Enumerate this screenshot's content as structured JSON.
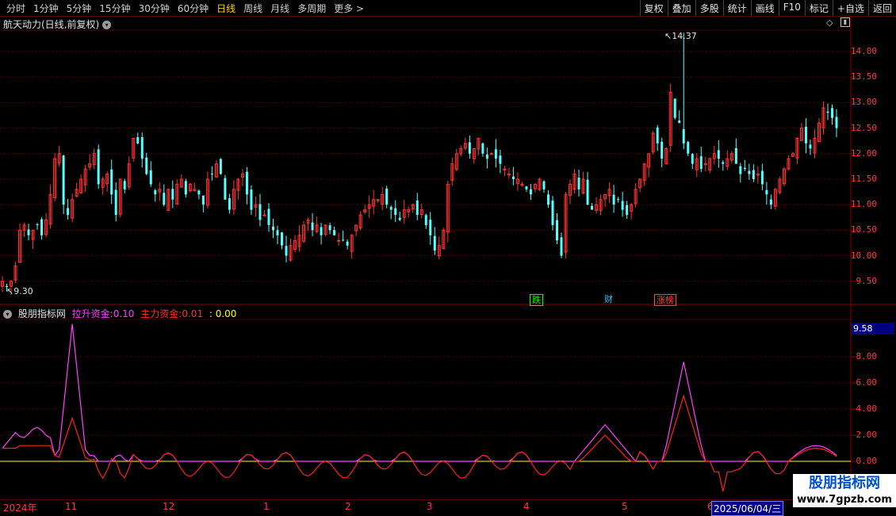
{
  "toolbar": {
    "periods": [
      "分时",
      "1分钟",
      "5分钟",
      "15分钟",
      "30分钟",
      "60分钟",
      "日线",
      "周线",
      "月线",
      "多周期",
      "更多 >"
    ],
    "active_period": "日线",
    "actions": [
      "复权",
      "叠加",
      "多股",
      "统计",
      "画线",
      "F10",
      "标记",
      "+自选",
      "返回"
    ]
  },
  "main_chart": {
    "title": "航天动力(日线,前复权)",
    "high_label": "14.37",
    "low_label": "9.30",
    "y_axis": [
      "14.00",
      "13.50",
      "13.00",
      "12.50",
      "12.00",
      "11.50",
      "11.00",
      "10.50",
      "10.00",
      "9.50"
    ],
    "markers": [
      {
        "text": "跌",
        "color": "#00ff00"
      },
      {
        "text": "财",
        "color": "#40c0ff"
      },
      {
        "text": "涨榜",
        "color": "#ff4040"
      }
    ],
    "up_color": "#ff3232",
    "down_color": "#54ffff"
  },
  "indicator": {
    "name": "股朋指标网",
    "line1_label": "拉升资金:",
    "line1_value": "0.10",
    "line2_label": "主力资金:",
    "line2_value": "0.01",
    "line3_value": ": 0.00",
    "current_value": "9.58",
    "y_axis": [
      "8.00",
      "6.00",
      "4.00",
      "2.00",
      "0.00"
    ],
    "colors": {
      "line1": "#ff40ff",
      "line2": "#ff2020",
      "line3": "#ffff00"
    }
  },
  "date_axis": {
    "labels": [
      "2024年",
      "11",
      "12",
      "1",
      "2",
      "3",
      "4",
      "5",
      "6"
    ],
    "current_date": "2025/06/04/三"
  },
  "watermark": {
    "title": "股朋指标网",
    "url": "www.7gpzb.com"
  }
}
